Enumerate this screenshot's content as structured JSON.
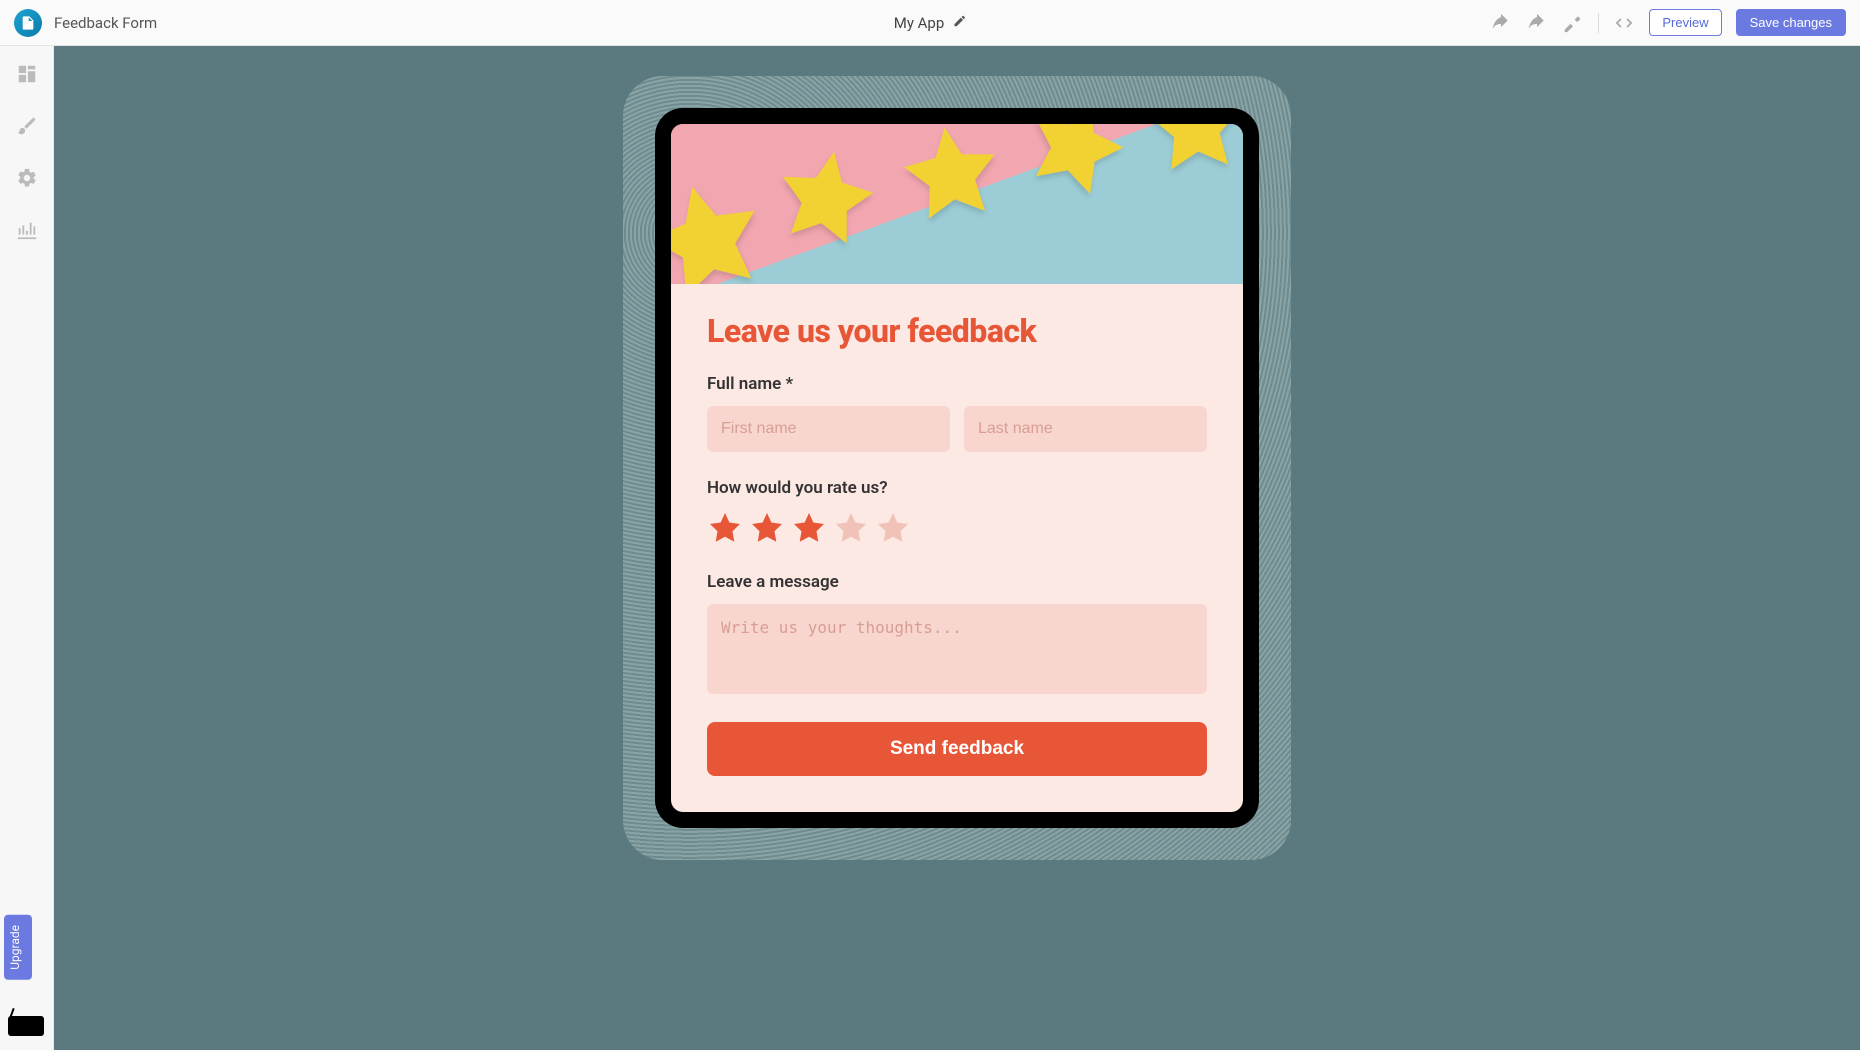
{
  "header": {
    "page_label": "Feedback Form",
    "app_name": "My App",
    "preview_label": "Preview",
    "save_label": "Save changes"
  },
  "sidebar": {
    "upgrade_label": "Upgrade"
  },
  "form": {
    "title": "Leave us your feedback",
    "full_name_label": "Full name *",
    "first_name_placeholder": "First name",
    "last_name_placeholder": "Last name",
    "rate_label": "How would you rate us?",
    "rating_value": 3,
    "rating_max": 5,
    "message_label": "Leave a message",
    "message_placeholder": "Write us your thoughts...",
    "submit_label": "Send feedback"
  },
  "colors": {
    "accent": "#e75637",
    "primary_button": "#6a7ae0",
    "canvas_bg": "#5b7a7f",
    "form_bg": "#fde9e4",
    "input_bg": "#f8d6cf"
  }
}
